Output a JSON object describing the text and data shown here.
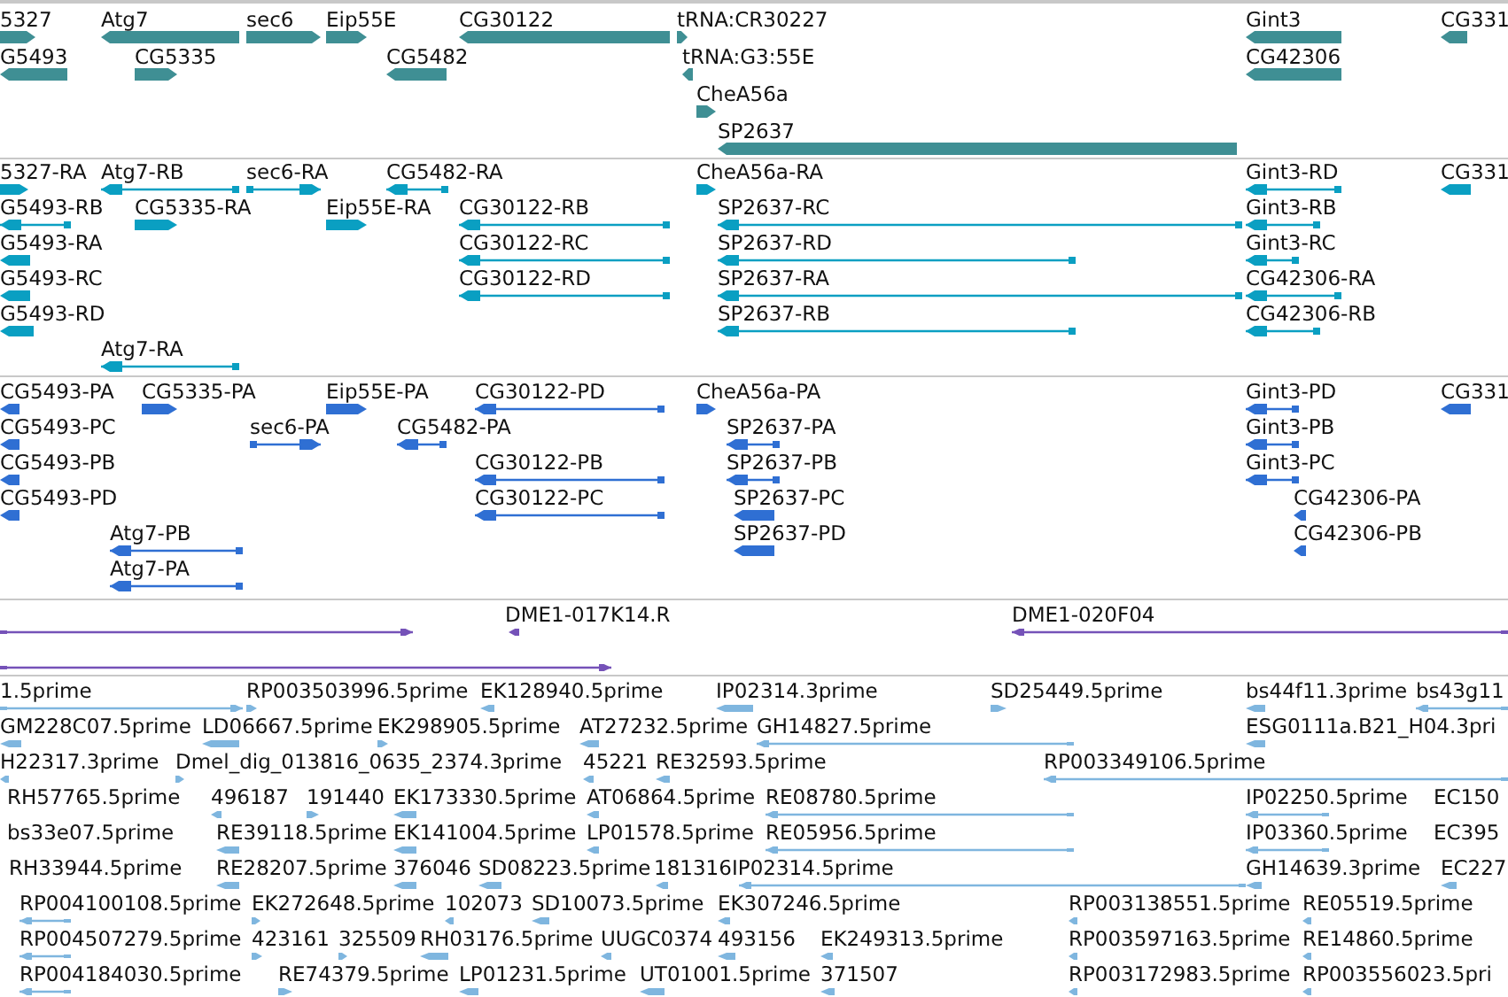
{
  "tracks": [
    {
      "kind": "gene",
      "color": "#3f8f94",
      "features": [
        {
          "label": "5327",
          "forward": true
        },
        {
          "label": "Atg7",
          "forward": false
        },
        {
          "label": "sec6",
          "forward": true
        },
        {
          "label": "Eip55E",
          "forward": true
        },
        {
          "label": "CG30122",
          "forward": false
        },
        {
          "label": "tRNA:CR30227",
          "forward": true
        },
        {
          "label": "Gint3",
          "forward": false
        },
        {
          "label": "CG331",
          "forward": false
        },
        {
          "label": "G5493",
          "forward": false
        },
        {
          "label": "CG5335",
          "forward": true
        },
        {
          "label": "CG5482",
          "forward": false
        },
        {
          "label": "tRNA:G3:55E",
          "forward": false
        },
        {
          "label": "CG42306",
          "forward": false
        },
        {
          "label": "CheA56a",
          "forward": true
        },
        {
          "label": "SP2637",
          "forward": false
        }
      ]
    },
    {
      "kind": "transcript",
      "color": "#0a9fc2",
      "features": [
        {
          "label": "5327-RA",
          "forward": true
        },
        {
          "label": "Atg7-RB",
          "forward": false
        },
        {
          "label": "sec6-RA",
          "forward": true
        },
        {
          "label": "CG5482-RA",
          "forward": false
        },
        {
          "label": "CheA56a-RA",
          "forward": true
        },
        {
          "label": "Gint3-RD",
          "forward": false
        },
        {
          "label": "CG331",
          "forward": false
        },
        {
          "label": "G5493-RB",
          "forward": false
        },
        {
          "label": "CG5335-RA",
          "forward": true
        },
        {
          "label": "Eip55E-RA",
          "forward": true
        },
        {
          "label": "CG30122-RB",
          "forward": false
        },
        {
          "label": "SP2637-RC",
          "forward": false
        },
        {
          "label": "Gint3-RB",
          "forward": false
        },
        {
          "label": "G5493-RA",
          "forward": false
        },
        {
          "label": "CG30122-RC",
          "forward": false
        },
        {
          "label": "SP2637-RD",
          "forward": false
        },
        {
          "label": "Gint3-RC",
          "forward": false
        },
        {
          "label": "G5493-RC",
          "forward": false
        },
        {
          "label": "CG30122-RD",
          "forward": false
        },
        {
          "label": "SP2637-RA",
          "forward": false
        },
        {
          "label": "CG42306-RA",
          "forward": false
        },
        {
          "label": "G5493-RD",
          "forward": false
        },
        {
          "label": "SP2637-RB",
          "forward": false
        },
        {
          "label": "CG42306-RB",
          "forward": false
        },
        {
          "label": "Atg7-RA",
          "forward": false
        }
      ]
    },
    {
      "kind": "transcript",
      "color": "#2f6fd3",
      "features": [
        {
          "label": "CG5493-PA",
          "forward": false
        },
        {
          "label": "CG5335-PA",
          "forward": true
        },
        {
          "label": "Eip55E-PA",
          "forward": true
        },
        {
          "label": "CG30122-PD",
          "forward": false
        },
        {
          "label": "CheA56a-PA",
          "forward": true
        },
        {
          "label": "Gint3-PD",
          "forward": false
        },
        {
          "label": "CG331",
          "forward": false
        },
        {
          "label": "CG5493-PC",
          "forward": false
        },
        {
          "label": "sec6-PA",
          "forward": true
        },
        {
          "label": "CG5482-PA",
          "forward": false
        },
        {
          "label": "SP2637-PA",
          "forward": false
        },
        {
          "label": "Gint3-PB",
          "forward": false
        },
        {
          "label": "CG5493-PB",
          "forward": false
        },
        {
          "label": "CG30122-PB",
          "forward": false
        },
        {
          "label": "SP2637-PB",
          "forward": false
        },
        {
          "label": "Gint3-PC",
          "forward": false
        },
        {
          "label": "CG5493-PD",
          "forward": false
        },
        {
          "label": "CG30122-PC",
          "forward": false
        },
        {
          "label": "SP2637-PC",
          "forward": false
        },
        {
          "label": "CG42306-PA",
          "forward": false
        },
        {
          "label": "Atg7-PB",
          "forward": false
        },
        {
          "label": "SP2637-PD",
          "forward": false
        },
        {
          "label": "CG42306-PB",
          "forward": false
        },
        {
          "label": "Atg7-PA",
          "forward": false
        }
      ]
    },
    {
      "kind": "clone",
      "color": "#7552b8",
      "features": [
        {
          "forward": true
        },
        {
          "label": "DME1-017K14.R",
          "forward": false
        },
        {
          "label": "DME1-020F04",
          "forward": false
        },
        {
          "forward": true
        }
      ]
    },
    {
      "kind": "est",
      "color": "#7fb6df",
      "features": [
        {
          "label": "1.5prime",
          "forward": true
        },
        {
          "label": "RP003503996.5prime",
          "forward": true
        },
        {
          "label": "EK128940.5prime",
          "forward": false
        },
        {
          "label": "IP02314.3prime",
          "forward": false
        },
        {
          "label": "SD25449.5prime",
          "forward": true
        },
        {
          "label": "bs44f11.3prime",
          "forward": false
        },
        {
          "label": "bs43g11",
          "forward": false
        },
        {
          "label": "GM228C07.5prime",
          "forward": false
        },
        {
          "label": "LD06667.5prime",
          "forward": false
        },
        {
          "label": "EK298905.5prime",
          "forward": true
        },
        {
          "label": "AT27232.5prime",
          "forward": false
        },
        {
          "label": "GH14827.5prime",
          "forward": false
        },
        {
          "label": "ESG0111a.B21_H04.3pri",
          "forward": false
        },
        {
          "label": "H22317.3prime",
          "forward": false
        },
        {
          "label": "Dmel_dig_013816_0635_2374.3prime",
          "forward": true
        },
        {
          "label": "45221",
          "forward": false
        },
        {
          "label": "RE32593.5prime",
          "forward": false
        },
        {
          "label": "RP003349106.5prime",
          "forward": false
        },
        {
          "label": "RH57765.5prime"
        },
        {
          "label": "496187",
          "forward": false
        },
        {
          "label": "191440",
          "forward": true
        },
        {
          "label": "EK173330.5prime",
          "forward": false
        },
        {
          "label": "AT06864.5prime",
          "forward": false
        },
        {
          "label": "RE08780.5prime",
          "forward": false
        },
        {
          "label": "IP02250.5prime",
          "forward": false
        },
        {
          "label": "EC150"
        },
        {
          "label": "bs33e07.5prime"
        },
        {
          "label": "RE39118.5prime",
          "forward": false
        },
        {
          "label": "EK141004.5prime",
          "forward": false
        },
        {
          "label": "LP01578.5prime",
          "forward": false
        },
        {
          "label": "RE05956.5prime",
          "forward": false
        },
        {
          "label": "IP03360.5prime",
          "forward": false
        },
        {
          "label": "EC395"
        },
        {
          "label": "RH33944.5prime"
        },
        {
          "label": "RE28207.5prime",
          "forward": false
        },
        {
          "label": "376046",
          "forward": false
        },
        {
          "label": "SD08223.5prime",
          "forward": false
        },
        {
          "label": "181316",
          "forward": false
        },
        {
          "label": "IP02314.5prime",
          "forward": false
        },
        {
          "label": "GH14639.3prime",
          "forward": false
        },
        {
          "label": "EC227",
          "forward": false
        },
        {
          "label": "RP004100108.5prime",
          "forward": false
        },
        {
          "label": "EK272648.5prime",
          "forward": true
        },
        {
          "label": "102073",
          "forward": false
        },
        {
          "label": "SD10073.5prime",
          "forward": false
        },
        {
          "label": "EK307246.5prime",
          "forward": false
        },
        {
          "label": "RP003138551.5prime",
          "forward": false
        },
        {
          "label": "RE05519.5prime",
          "forward": false
        },
        {
          "label": "RP004507279.5prime",
          "forward": false
        },
        {
          "label": "423161",
          "forward": true
        },
        {
          "label": "325509",
          "forward": true
        },
        {
          "label": "RH03176.5prime",
          "forward": false
        },
        {
          "label": "UUGC0374",
          "forward": false
        },
        {
          "label": "493156",
          "forward": false
        },
        {
          "label": "EK249313.5prime",
          "forward": false
        },
        {
          "label": "RP003597163.5prime",
          "forward": false
        },
        {
          "label": "RE14860.5prime",
          "forward": false
        },
        {
          "label": "RP004184030.5prime",
          "forward": false
        },
        {
          "label": "RE74379.5prime",
          "forward": true
        },
        {
          "label": "LP01231.5prime",
          "forward": false
        },
        {
          "label": "UT01001.5prime",
          "forward": false
        },
        {
          "label": "371507",
          "forward": false
        },
        {
          "label": "RP003172983.5prime",
          "forward": false
        },
        {
          "label": "RP003556023.5pri",
          "forward": false
        }
      ]
    }
  ]
}
